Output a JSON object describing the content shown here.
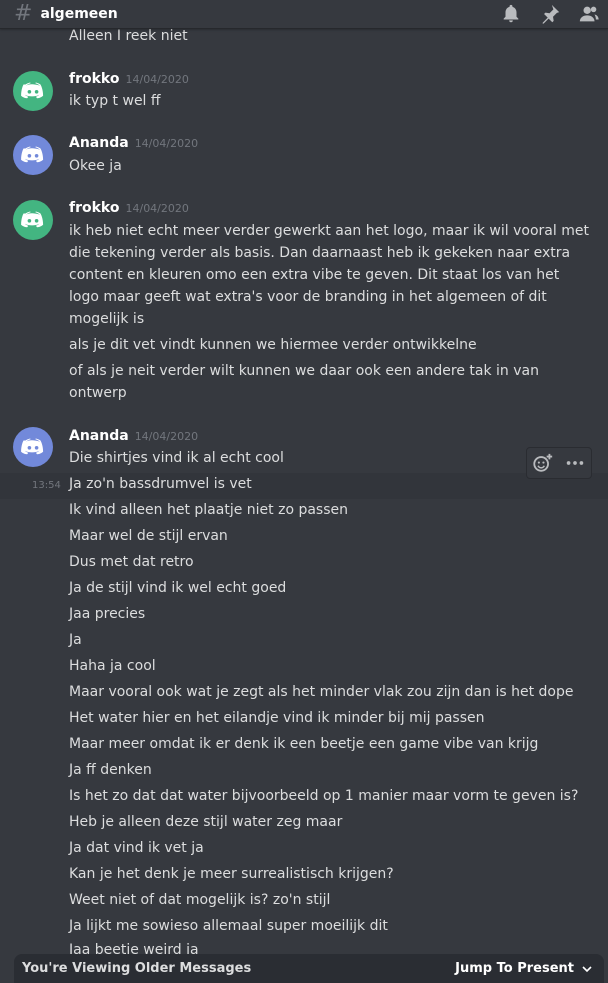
{
  "channel": {
    "name": "algemeen"
  },
  "header_icons": [
    "bell-icon",
    "pin-icon",
    "members-icon"
  ],
  "partial_top_line": "Alleen I reek niet",
  "messages": [
    {
      "author": "frokko",
      "date": "14/04/2020",
      "avatar_color": "#43b581",
      "lines": [
        "ik typ t wel ff"
      ]
    },
    {
      "author": "Ananda",
      "date": "14/04/2020",
      "avatar_color": "#7289da",
      "lines": [
        "Okee ja"
      ]
    },
    {
      "author": "frokko",
      "date": "14/04/2020",
      "avatar_color": "#43b581",
      "lines": [
        "ik heb niet echt meer verder gewerkt aan het logo, maar ik wil vooral met",
        "die tekening verder als basis. Dan daarnaast heb ik gekeken naar extra",
        "content en kleuren omo een extra vibe te geven. Dit staat los van het",
        "logo maar geeft wat extra's voor de branding in het algemeen of dit",
        "mogelijk is",
        "als je dit vet vindt kunnen we hiermee verder ontwikkelne",
        "of als je neit verder wilt kunnen we daar ook een andere tak in van",
        "ontwerp"
      ]
    },
    {
      "author": "Ananda",
      "date": "14/04/2020",
      "avatar_color": "#7289da",
      "hover_time": "13:54",
      "lines": [
        "Die shirtjes vind ik al echt cool",
        "Ja zo'n bassdrumvel is vet",
        "Ik vind alleen het plaatje niet zo passen",
        "Maar wel de stijl ervan",
        "Dus met dat retro",
        "Ja de stijl vind ik wel echt goed",
        "Jaa precies",
        "Ja",
        "Haha ja cool",
        "Maar vooral ook wat je zegt als het minder vlak zou zijn dan is het dope",
        "Het water hier en het eilandje vind ik minder bij mij passen",
        "Maar meer omdat ik er denk ik een beetje een game vibe van krijg",
        "Ja ff denken",
        "Is het zo dat dat water bijvoorbeeld op 1 manier maar vorm te geven is?",
        "Heb je alleen deze stijl water zeg maar",
        "Ja dat vind ik vet ja",
        "Kan je het denk je meer surrealistisch krijgen?",
        "Weet niet of dat mogelijk is? zo'n stijl",
        "Ja lijkt me sowieso allemaal super moeilijk dit",
        "Jaa beetje weird ja"
      ]
    }
  ],
  "toolbar": {
    "icons": [
      "add-reaction-icon",
      "more-options-icon"
    ]
  },
  "older_bar": {
    "text": "You're Viewing Older Messages",
    "jump_label": "Jump To Present",
    "jump_icon": "chevron-down-icon"
  }
}
